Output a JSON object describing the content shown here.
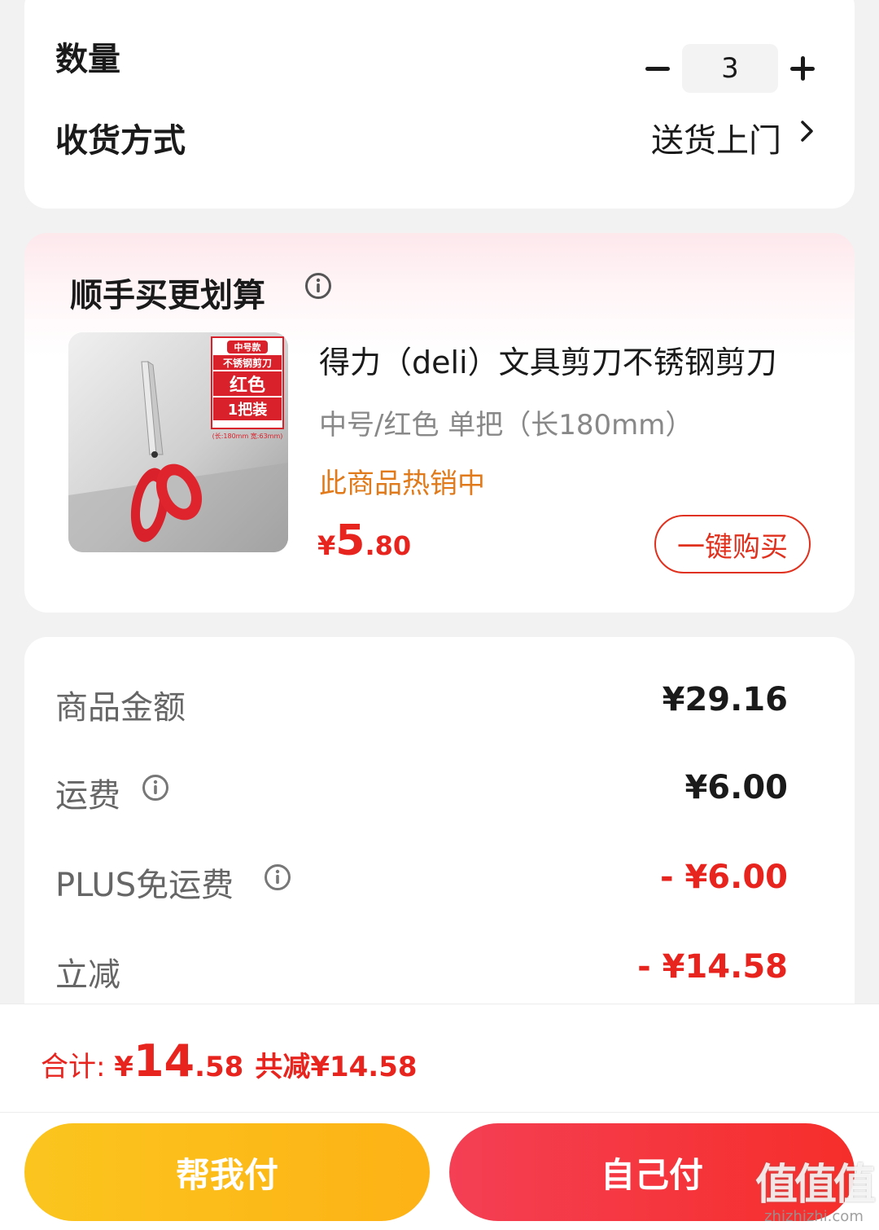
{
  "quantity": {
    "label": "数量",
    "value": "3"
  },
  "shipping": {
    "label": "收货方式",
    "value": "送货上门"
  },
  "recommend": {
    "title": "顺手买更划算",
    "product": {
      "name": "得力（deli）文具剪刀不锈钢剪刀",
      "spec": "中号/红色 单把（长180mm）",
      "hot": "此商品热销中",
      "price_symbol": "¥",
      "price_int": "5",
      "price_dec": ".80",
      "buy_label": "一键购买",
      "image": {
        "tag": "中号款",
        "line1": "不锈钢剪刀",
        "color": "红色",
        "pack": "1把装",
        "size": "(长:180mm  宽:63mm)"
      }
    }
  },
  "summary": {
    "rows": [
      {
        "label": "商品金额",
        "value": "¥29.16"
      },
      {
        "label": "运费",
        "value": "¥6.00"
      },
      {
        "label": "PLUS免运费",
        "value": "- ¥6.00"
      },
      {
        "label": "立减",
        "value": "- ¥14.58"
      }
    ]
  },
  "footer": {
    "total_label": "合计: ",
    "total_symbol": "¥",
    "total_int": "14",
    "total_dec": ".58",
    "saved": "共减¥14.58",
    "help_pay": "帮我付",
    "self_pay": "自己付"
  },
  "watermark": {
    "main": "值值值",
    "site": "zhizhizhi.com"
  },
  "colors": {
    "accent_red": "#e8241f",
    "hot_orange": "#e07a1a",
    "help_yellow": "#fdb215"
  }
}
